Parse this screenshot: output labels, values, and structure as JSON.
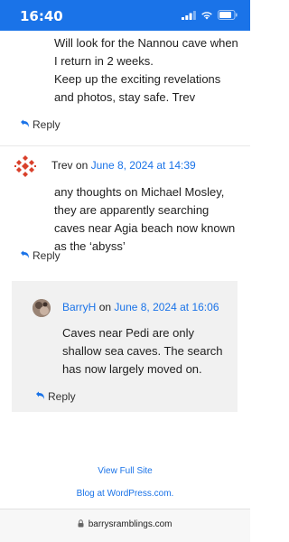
{
  "status": {
    "time": "16:40"
  },
  "comment1": {
    "lines": [
      "Will look for the Nannou cave when I return in 2 weeks.",
      "Keep up the exciting revelations and photos, stay safe. Trev"
    ],
    "reply_label": "Reply"
  },
  "comment2": {
    "author": "Trev",
    "on_word": "on",
    "date": "June 8, 2024 at 14:39",
    "text": "any thoughts on Michael Mosley, they are apparently searching caves near Agia beach now known as the ‘abyss’",
    "reply_label": "Reply"
  },
  "comment3": {
    "author": "BarryH",
    "on_word": "on",
    "date": "June 8, 2024 at 16:06",
    "text": "Caves near Pedi are only shallow sea caves. The search has now largely moved on.",
    "reply_label": "Reply"
  },
  "footer": {
    "view_full_site": "View Full Site",
    "blog_at": "Blog at WordPress.com."
  },
  "browser": {
    "url": "barrysramblings.com"
  },
  "colors": {
    "accent": "#1a73e8",
    "status_bar": "#1a73e8",
    "nested_bg": "#f1f1f1"
  },
  "icons": [
    "signal-icon",
    "wifi-icon",
    "battery-icon",
    "reply-icon",
    "lock-icon"
  ]
}
